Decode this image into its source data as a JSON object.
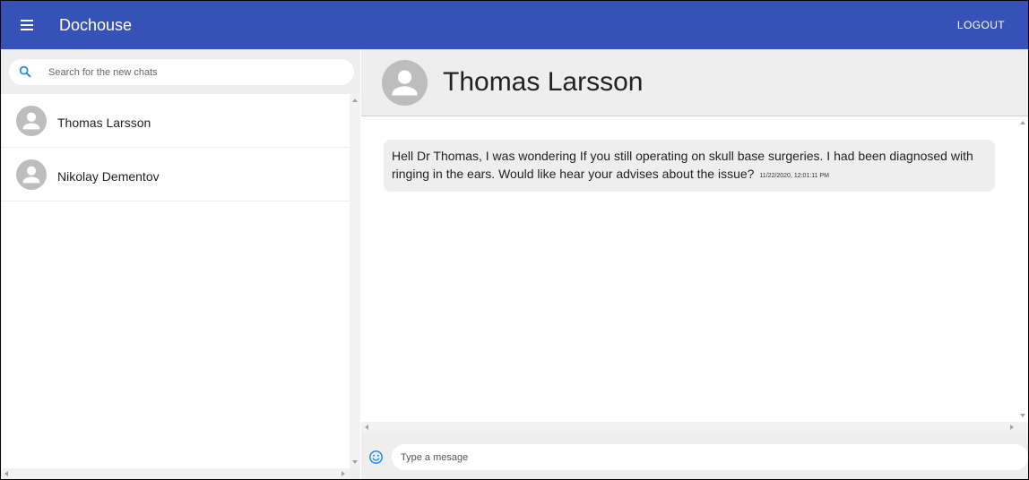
{
  "appbar": {
    "menu_icon": "menu-icon",
    "title": "Dochouse",
    "logout_label": "LOGOUT",
    "color": "#3652b9"
  },
  "sidebar": {
    "search": {
      "icon": "search-icon",
      "placeholder": "Search for the new chats",
      "value": ""
    },
    "chats": [
      {
        "name": "Thomas Larsson",
        "avatar_icon": "person-icon"
      },
      {
        "name": "Nikolay Dementov",
        "avatar_icon": "person-icon"
      }
    ]
  },
  "chat": {
    "header_name": "Thomas Larsson",
    "messages": [
      {
        "text": "Hell Dr Thomas, I was wondering If you still operating on skull base surgeries. I had been diagnosed with ringing in the ears. Would like hear your advises about the issue?",
        "time": "11/22/2020, 12:01:11 PM"
      }
    ],
    "composer": {
      "emoji_icon": "emoji-icon",
      "placeholder": "Type a mesage",
      "value": ""
    }
  },
  "colors": {
    "accent": "#3652b9",
    "icon_blue": "#1e88e5",
    "panel_gray": "#eeeeee",
    "avatar_gray": "#bdbdbd"
  }
}
